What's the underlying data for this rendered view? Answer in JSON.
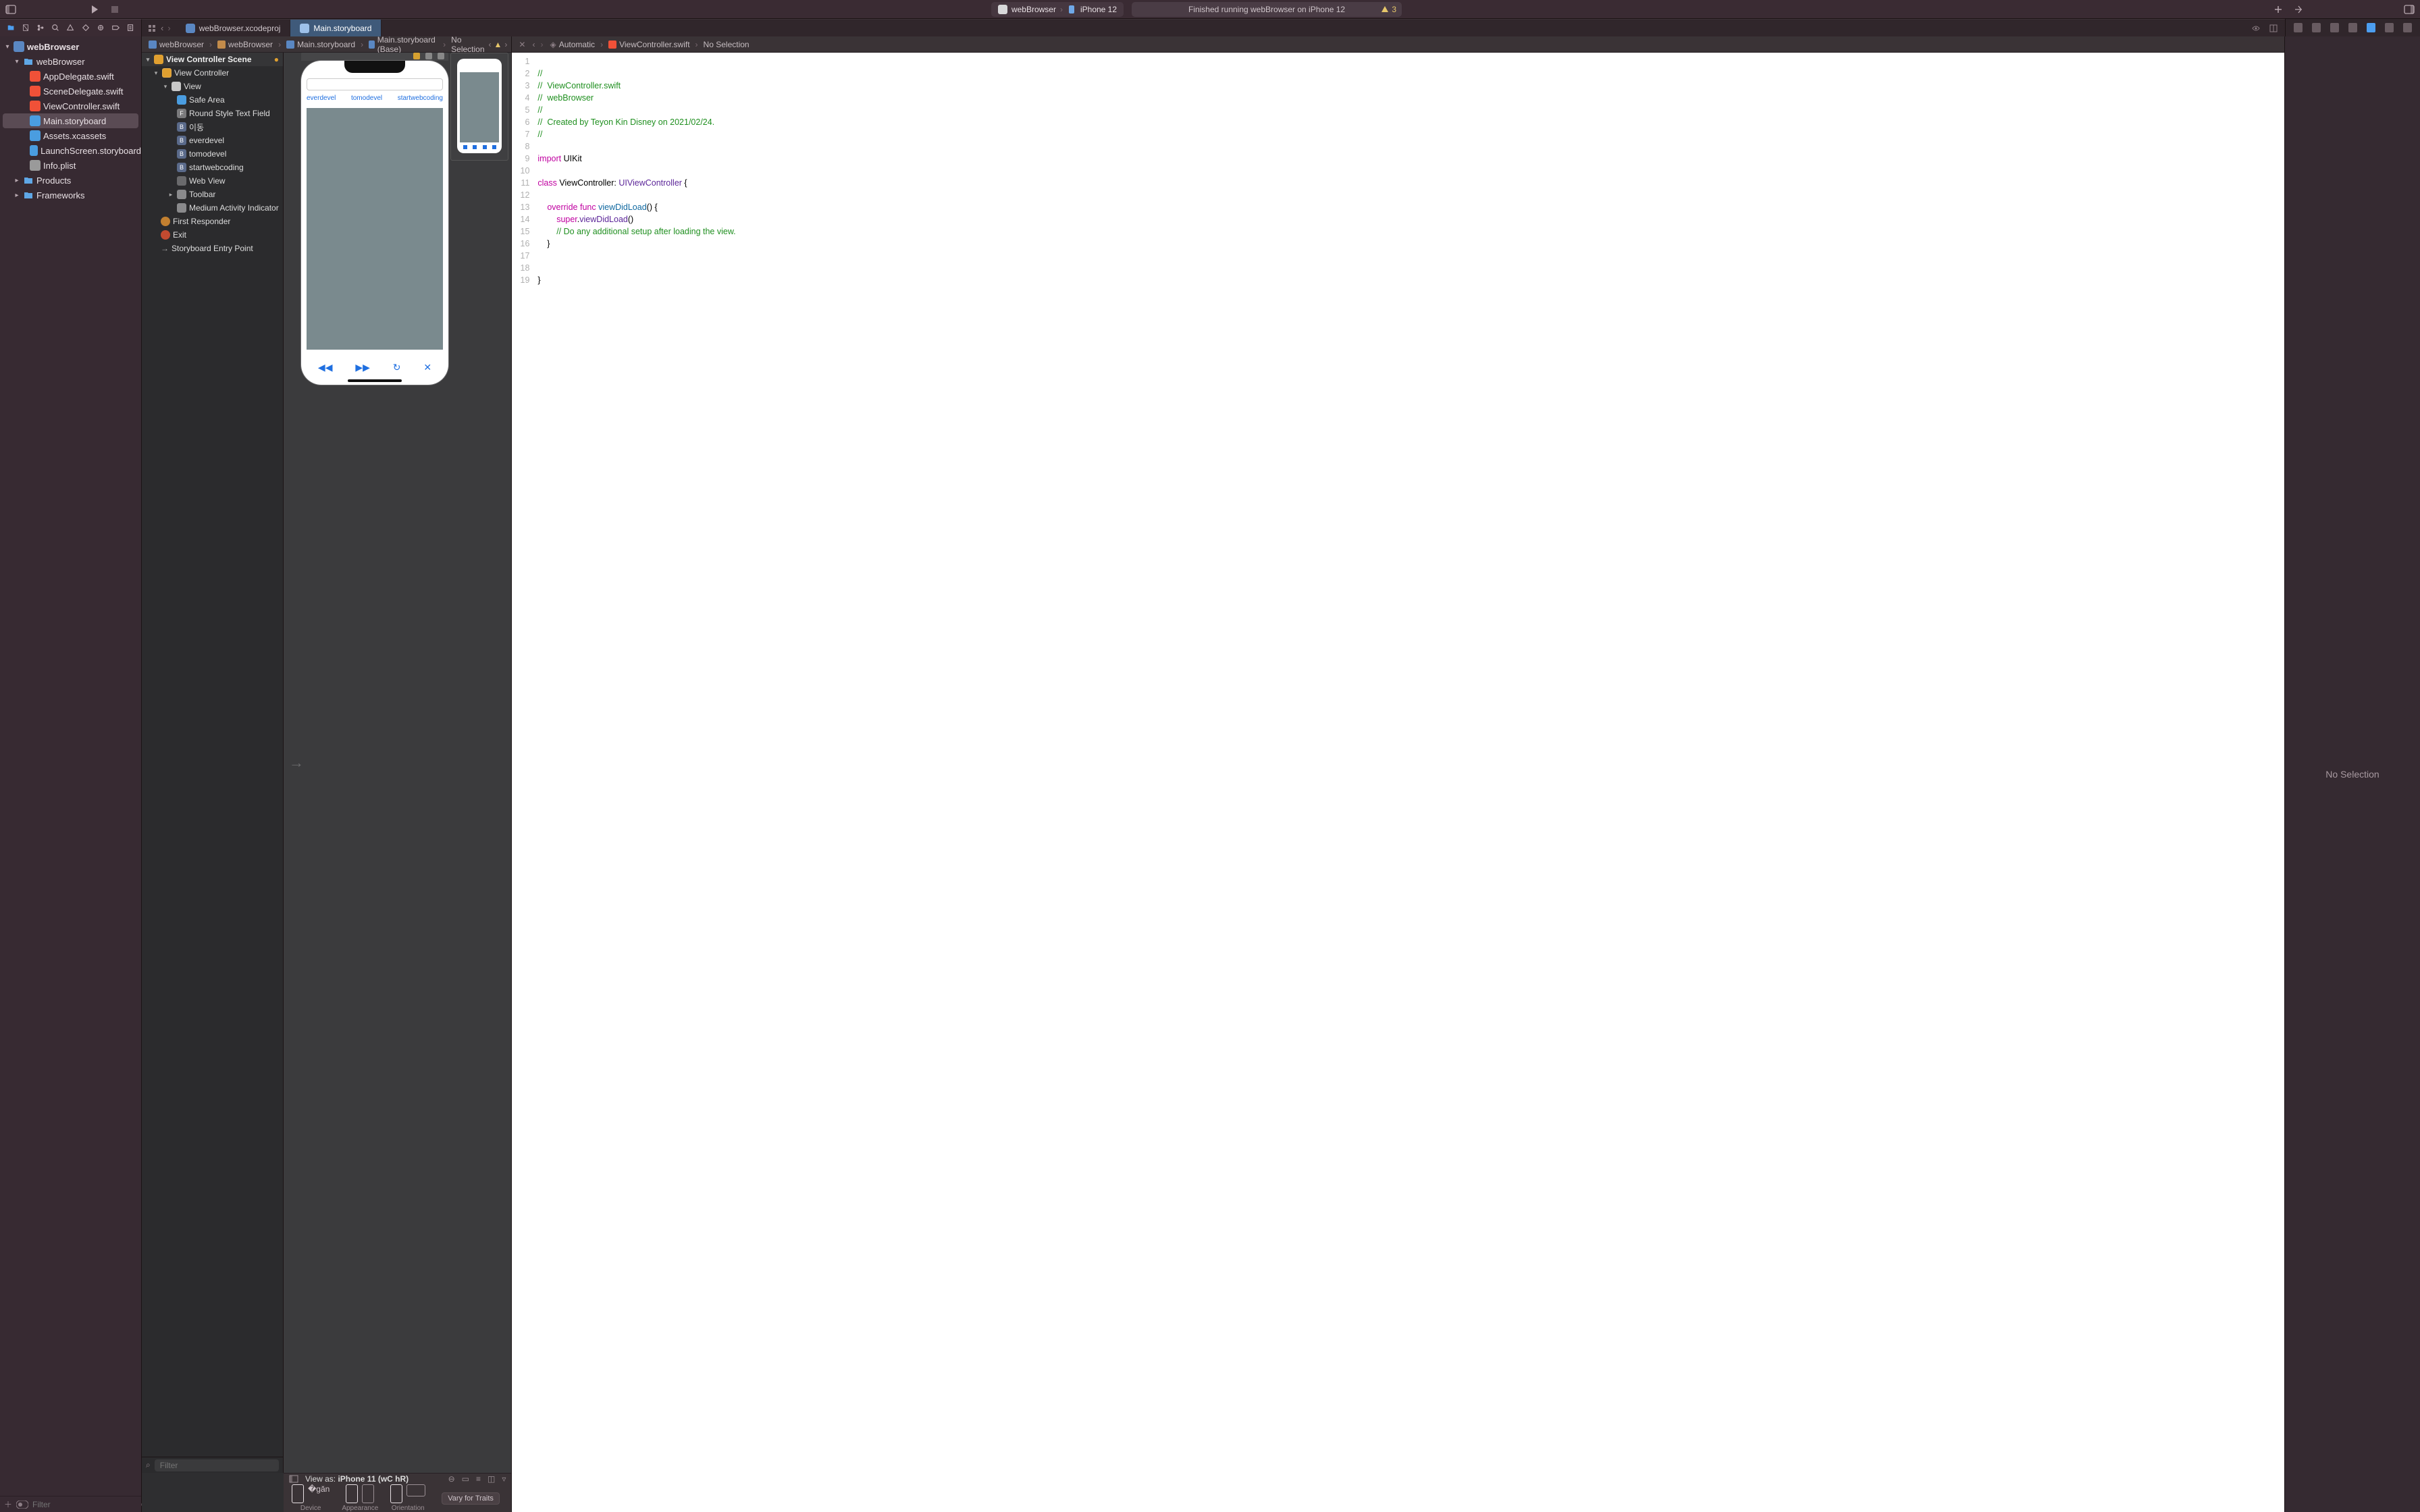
{
  "titlebar": {
    "scheme_app": "webBrowser",
    "scheme_device": "iPhone 12",
    "status": "Finished running webBrowser on iPhone 12",
    "warning_count": "3"
  },
  "tabs": {
    "project": "webBrowser.xcodeproj",
    "storyboard": "Main.storyboard"
  },
  "navigator": {
    "root": "webBrowser",
    "group": "webBrowser",
    "files": {
      "app_delegate": "AppDelegate.swift",
      "scene_delegate": "SceneDelegate.swift",
      "view_controller": "ViewController.swift",
      "main_storyboard": "Main.storyboard",
      "assets": "Assets.xcassets",
      "launch": "LaunchScreen.storyboard",
      "info": "Info.plist"
    },
    "products": "Products",
    "frameworks": "Frameworks",
    "filter_placeholder": "Filter"
  },
  "storyboard_jump": {
    "c1": "webBrowser",
    "c2": "webBrowser",
    "c3": "Main.storyboard",
    "c4": "Main.storyboard (Base)",
    "c5": "No Selection"
  },
  "outline": {
    "scene": "View Controller Scene",
    "vc": "View Controller",
    "view": "View",
    "safe": "Safe Area",
    "textfield": "Round Style Text Field",
    "btn_go": "이동",
    "btn_everdevel": "everdevel",
    "btn_tomodevel": "tomodevel",
    "btn_startwebcoding": "startwebcoding",
    "webview": "Web View",
    "toolbar": "Toolbar",
    "activity": "Medium Activity Indicator",
    "first_responder": "First Responder",
    "exit": "Exit",
    "entry": "Storyboard Entry Point",
    "filter_placeholder": "Filter"
  },
  "phone": {
    "link1": "everdevel",
    "link2": "tomodevel",
    "link3": "startwebcoding"
  },
  "devicebar": {
    "view_as_prefix": "View as: ",
    "view_as_device": "iPhone 11 (wC hR)",
    "device_label": "Device",
    "appearance_label": "Appearance",
    "orientation_label": "Orientation",
    "vary": "Vary for Traits"
  },
  "source_jump": {
    "automatic": "Automatic",
    "file": "ViewController.swift",
    "sel": "No Selection"
  },
  "code": {
    "l1": "//",
    "l2_a": "//  ",
    "l2_b": "ViewController.swift",
    "l3_a": "//  ",
    "l3_b": "webBrowser",
    "l4": "//",
    "l5_a": "//  ",
    "l5_b": "Created by Teyon Kin Disney on 2021/02/24.",
    "l6": "//",
    "l7": "",
    "l8_a": "import",
    "l8_b": " UIKit",
    "l9": "",
    "l10_a": "class",
    "l10_b": " ViewController: ",
    "l10_c": "UIViewController",
    "l10_d": " {",
    "l11": "",
    "l12_a": "    ",
    "l12_b": "override",
    "l12_c": " ",
    "l12_d": "func",
    "l12_e": " ",
    "l12_f": "viewDidLoad",
    "l12_g": "() {",
    "l13_a": "        ",
    "l13_b": "super",
    "l13_c": ".",
    "l13_d": "viewDidLoad",
    "l13_e": "()",
    "l14_a": "        ",
    "l14_b": "// Do any additional setup after loading the view.",
    "l15": "    }",
    "l16": "",
    "l17": "",
    "l18": "}",
    "l19": ""
  },
  "line_numbers": [
    "1",
    "2",
    "3",
    "4",
    "5",
    "6",
    "7",
    "8",
    "9",
    "10",
    "11",
    "12",
    "13",
    "14",
    "15",
    "16",
    "17",
    "18",
    "19"
  ],
  "inspector": {
    "empty": "No Selection"
  }
}
